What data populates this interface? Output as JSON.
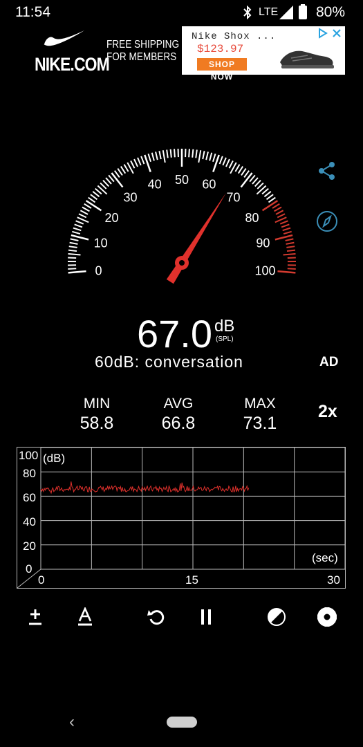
{
  "status": {
    "time": "11:54",
    "network": "LTE",
    "battery": "80%"
  },
  "ad": {
    "brand": "NIKE.COM",
    "promo_line1": "FREE SHIPPING",
    "promo_line2": "FOR MEMBERS",
    "product": "Nike Shox ...",
    "price": "$123.97",
    "cta": "SHOP NOW"
  },
  "gauge": {
    "ticks": [
      "0",
      "10",
      "20",
      "30",
      "40",
      "50",
      "60",
      "70",
      "80",
      "90",
      "100"
    ],
    "needle_value": 67.0
  },
  "reading": {
    "value": "67.0",
    "unit": "dB",
    "unit_sub": "(SPL)",
    "reference": "60dB: conversation",
    "ad_toggle": "AD"
  },
  "stats": {
    "min_label": "MIN",
    "min": "58.8",
    "avg_label": "AVG",
    "avg": "66.8",
    "max_label": "MAX",
    "max": "73.1",
    "speed": "2x"
  },
  "graph": {
    "y_unit": "(dB)",
    "x_unit": "(sec)",
    "y_ticks": [
      "100",
      "80",
      "60",
      "40",
      "20",
      "0"
    ],
    "x_ticks": [
      "0",
      "15",
      "30"
    ],
    "y_range": [
      0,
      100
    ],
    "x_range": [
      0,
      30
    ],
    "trace_end_sec": 20.5,
    "trace_level_db": 66
  },
  "colors": {
    "needle": "#e0312c",
    "trace": "#e0312c",
    "red_zone": "#d33a2f"
  },
  "icons": [
    "share-icon",
    "compass-icon",
    "calibrate-icon",
    "weighting-icon",
    "reset-icon",
    "pause-icon",
    "theme-icon",
    "settings-icon"
  ]
}
